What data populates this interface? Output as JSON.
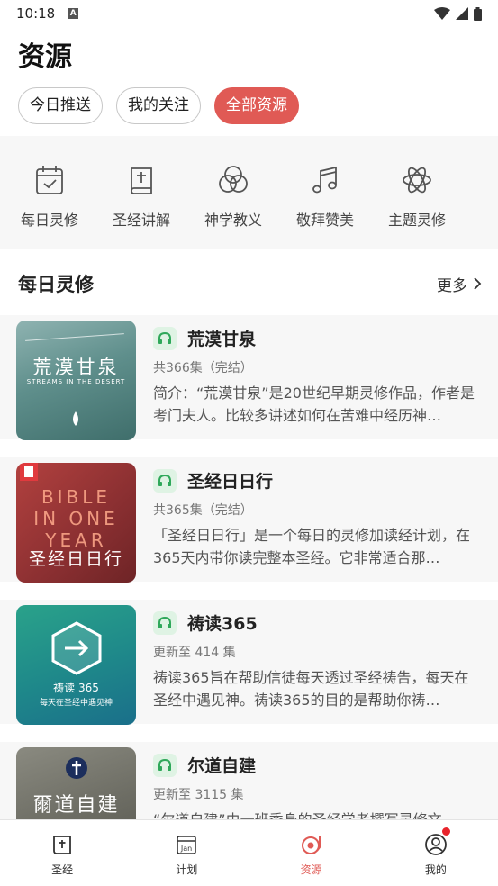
{
  "status": {
    "time": "10:18",
    "a_icon": "A"
  },
  "page": {
    "title": "资源"
  },
  "tabs": [
    {
      "label": "今日推送",
      "active": false
    },
    {
      "label": "我的关注",
      "active": false
    },
    {
      "label": "全部资源",
      "active": true
    }
  ],
  "categories": [
    {
      "label": "每日灵修",
      "icon": "calendar-check-icon"
    },
    {
      "label": "圣经讲解",
      "icon": "bible-book-icon"
    },
    {
      "label": "神学教义",
      "icon": "venn-circles-icon"
    },
    {
      "label": "敬拜赞美",
      "icon": "music-note-icon"
    },
    {
      "label": "主题灵修",
      "icon": "atom-icon"
    }
  ],
  "section": {
    "title": "每日灵修",
    "more_label": "更多"
  },
  "items": [
    {
      "title": "荒漠甘泉",
      "count": "共366集（完结）",
      "desc": "简介：“荒漠甘泉”是20世纪早期灵修作品，作者是考门夫人。比较多讲述如何在苦难中经历神…",
      "thumb_title": "荒漠甘泉",
      "thumb_sub": "STREAMS IN THE DESERT"
    },
    {
      "title": "圣经日日行",
      "count": "共365集（完结）",
      "desc": "「圣经日日行」是一个每日的灵修加读经计划，在365天内带你读完整本圣经。它非常适合那…",
      "thumb_line1": "BIBLE",
      "thumb_line2": "IN ONE",
      "thumb_line3": "YEAR",
      "thumb_title": "圣经日日行"
    },
    {
      "title": "祷读365",
      "count": "更新至 414 集",
      "desc": "祷读365旨在帮助信徒每天透过圣经祷告，每天在圣经中遇见神。祷读365的目的是帮助你祷…",
      "thumb_title": "祷读 365",
      "thumb_sub": "每天在圣经中遇见神"
    },
    {
      "title": "尔道自建",
      "count": "更新至 3115 集",
      "desc": "“尔道自建”由一班委身的圣经学者撰写灵修文",
      "thumb_title": "爾道自建"
    }
  ],
  "nav": [
    {
      "label": "圣经",
      "icon": "bible-icon",
      "active": false
    },
    {
      "label": "计划",
      "icon": "calendar-jan-icon",
      "active": false,
      "icon_text": "Jan"
    },
    {
      "label": "资源",
      "icon": "record-player-icon",
      "active": true
    },
    {
      "label": "我的",
      "icon": "user-profile-icon",
      "active": false
    }
  ],
  "colors": {
    "accent": "#e05a55",
    "audio_green": "#2fa85a",
    "badge_dot": "#e8242c"
  }
}
